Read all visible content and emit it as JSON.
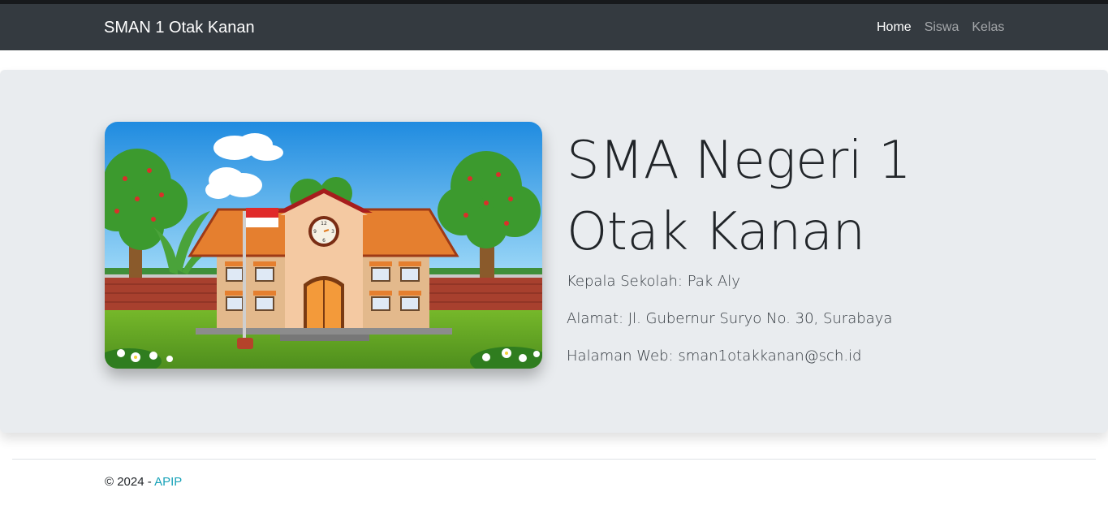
{
  "navbar": {
    "brand": "SMAN 1 Otak Kanan",
    "links": [
      {
        "label": "Home",
        "active": true
      },
      {
        "label": "Siswa",
        "active": false
      },
      {
        "label": "Kelas",
        "active": false
      }
    ]
  },
  "hero": {
    "title_line1": "SMA Negeri 1",
    "title_line2": "Otak Kanan",
    "principal": "Kepala Sekolah: Pak Aly",
    "address": "Alamat: Jl. Gubernur Suryo No. 30, Surabaya",
    "website": "Halaman Web: sman1otakkanan@sch.id",
    "illustration_clock_numbers": [
      "12",
      "3",
      "6",
      "9"
    ]
  },
  "footer": {
    "copyright": "© 2024 - ",
    "author_link": "APIP"
  },
  "colors": {
    "navbar_bg": "#343a40",
    "jumbotron_bg": "#e9ecef",
    "link_accent": "#17a2b8"
  }
}
